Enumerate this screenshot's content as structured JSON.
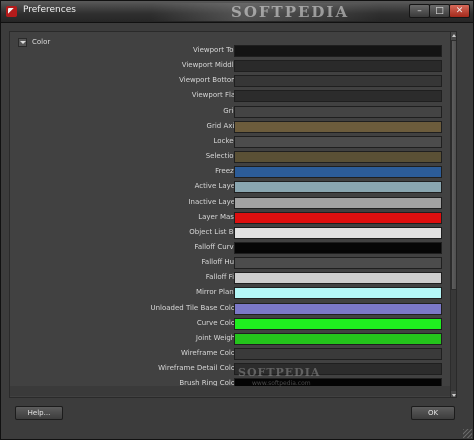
{
  "window": {
    "title": "Preferences",
    "watermark": "SOFTPEDIA",
    "controls": {
      "minimize": "–",
      "maximize": "□",
      "close": "✕"
    }
  },
  "section": {
    "title": "Color"
  },
  "colors": [
    {
      "label": "Viewport Top",
      "value": "#141414"
    },
    {
      "label": "Viewport Middle",
      "value": "#2a2a2a"
    },
    {
      "label": "Viewport Bottom",
      "value": "#363636"
    },
    {
      "label": "Viewport Flat",
      "value": "#2c2c2c"
    },
    {
      "label": "Grid",
      "value": "#444444"
    },
    {
      "label": "Grid Axis",
      "value": "#6c5c3c"
    },
    {
      "label": "Locked",
      "value": "#4c4c4c"
    },
    {
      "label": "Selection",
      "value": "#5a5035"
    },
    {
      "label": "Freeze",
      "value": "#2c5c98"
    },
    {
      "label": "Active Layer",
      "value": "#8aa6b0"
    },
    {
      "label": "Inactive Layer",
      "value": "#a2a2a2"
    },
    {
      "label": "Layer Mask",
      "value": "#dd0f0f"
    },
    {
      "label": "Object List Bg",
      "value": "#e2e2e2"
    },
    {
      "label": "Falloff Curve",
      "value": "#060606"
    },
    {
      "label": "Falloff Hull",
      "value": "#4c4c4c"
    },
    {
      "label": "Falloff Fill",
      "value": "#cdcdcd"
    },
    {
      "label": "Mirror Plane",
      "value": "#b4f6f6"
    },
    {
      "label": "Unloaded Tile Base Color",
      "value": "#7b78c8"
    },
    {
      "label": "Curve Color",
      "value": "#1fef1f"
    },
    {
      "label": "Joint Weight",
      "value": "#24c41c"
    },
    {
      "label": "Wireframe Color",
      "value": "#3a3a3a"
    },
    {
      "label": "Wireframe Detail Color",
      "value": "#2c2c2c"
    },
    {
      "label": "Brush Ring Color",
      "value": "#040404"
    }
  ],
  "watermark_mid": {
    "text": "SOFTPEDIA",
    "sub": "www.softpedia.com"
  },
  "footer": {
    "help_label": "Help...",
    "ok_label": "OK"
  }
}
